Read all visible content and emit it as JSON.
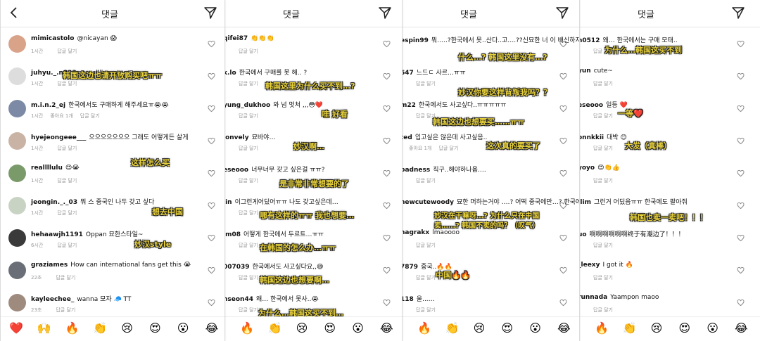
{
  "header_title": "댓글",
  "panel1": {
    "comments": [
      {
        "user": "mimicastolo",
        "text": "@nicayan 😱",
        "time": "1시간",
        "likes": "",
        "reply": "답글 달기",
        "anno": ""
      },
      {
        "user": "juhyu._.n822",
        "text": "@reallll._water  ㅋ‑",
        "time": "1시간",
        "likes": "",
        "reply": "답글 달기",
        "anno": "韩国这边也请开放购买吧ㅠㅠ"
      },
      {
        "user": "m.i.n.2_ej",
        "text": "한국에서도 구매하게 해주세요ㅠ😭😭",
        "time": "1시간",
        "likes": "좋아요 1개",
        "reply": "답글 달기",
        "anno": ""
      },
      {
        "user": "hyejeongeee___",
        "text": "으으으으으으으 그래도 어떻게든 살게",
        "time": "1시간",
        "likes": "",
        "reply": "답글 달기",
        "anno": "这样怎么买"
      },
      {
        "user": "reallllulu",
        "text": "😍😭",
        "time": "1시간",
        "likes": "",
        "reply": "답글 달기",
        "anno": ""
      },
      {
        "user": "jeongin._._03",
        "text": "뭐 스 중국인 나두 갖고 싶다",
        "time": "1시간",
        "likes": "",
        "reply": "답글 달기",
        "anno": "想去中国"
      },
      {
        "user": "hehaawjh1191",
        "text": "Oppan 묘한스타일~",
        "time": "6시간",
        "likes": "",
        "reply": "답글 달기",
        "anno": "妙汉style"
      },
      {
        "user": "graziames",
        "text": "How can international fans get this 😭",
        "time": "22초",
        "likes": "",
        "reply": "답글 달기",
        "anno": ""
      },
      {
        "user": "kayleechee_",
        "text": "wanna 모자 🧢 TT",
        "time": "23초",
        "likes": "",
        "reply": "답글 달기",
        "anno": ""
      }
    ]
  },
  "panel2": {
    "comments": [
      {
        "user": "qifei87",
        "text": "👏👏👏",
        "time": "",
        "likes": "",
        "reply": "답글 달기",
        "anno": ""
      },
      {
        "user": "k.lo",
        "text": "한국에서 구매를 못 해.. ?",
        "time": "",
        "likes": "",
        "reply": "답글 달기",
        "anno": "韩国这里为什么买不到…?"
      },
      {
        "user": "yung_dukhoo",
        "text": "와 넘 멋쳐 ,,,😳❤️",
        "time": "",
        "likes": "",
        "reply": "답글 달기",
        "anno": "哇 好看"
      },
      {
        "user": "lonvely",
        "text": "묘바야…",
        "time": "",
        "likes": "",
        "reply": "답글 달기",
        "anno": "妙汉啊…"
      },
      {
        "user": "eseooo",
        "text": "너무너무 갖고 싶은걸 ㅠㅠ?",
        "time": "",
        "likes": "",
        "reply": "답글 달기",
        "anno": "是非常非常想要的了"
      },
      {
        "user": "jin",
        "text": "이그런게어딨어ㅠㅠ 나도 갖고싶은데…",
        "time": "",
        "likes": "",
        "reply": "답글 달기",
        "anno": "哪有这样的ㅠㅠ 我也想要…"
      },
      {
        "user": "im08",
        "text": "어떻게 한국에서 두르트…ㅠㅠ",
        "time": "",
        "likes": "",
        "reply": "답글 달기",
        "anno": "在韩国的怎么办…ㅠㅠ"
      },
      {
        "user": "007039",
        "text": "한국에서도 사고싶다요,,😅",
        "time": "",
        "likes": "",
        "reply": "답글 달기",
        "anno": "韩国这边也想要啊…"
      },
      {
        "user": "nseon44",
        "text": "왜… 한국에서 못사..😭",
        "time": "",
        "likes": "",
        "reply": "답글 달기",
        "anno": "为什么…韩国这买不到…"
      }
    ]
  },
  "panel3": {
    "comments": [
      {
        "user": "espin99",
        "text": "뭐..…?한국에서 못..산다..고….??신묘한 너 이 배신하지?????",
        "time": "",
        "likes": "",
        "reply": "",
        "anno": "什么…? 韩国这里没有…?"
      },
      {
        "user": "647",
        "text": "느드ㄷ 사르…ㅠㅠ",
        "time": "",
        "likes": "",
        "reply": "답글 달기",
        "anno": "妙汉你要这样背叛我吗？？"
      },
      {
        "user": "m22",
        "text": "한국에서도 사고싶다..ㅠㅠㅠㅠㅠ",
        "time": "",
        "likes": "",
        "reply": "답글 달기",
        "anno": "韩国这边也想要买……ㅠㅠ"
      },
      {
        "user": "ted",
        "text": "입고싶은 않은데 사고싶음..",
        "time": "",
        "likes": "좋아요 1개",
        "reply": "답글 달기",
        "anno": "这次真的要买了"
      },
      {
        "user": "badness",
        "text": "직구..해야하나욤….",
        "time": "",
        "likes": "",
        "reply": "답글 달기",
        "anno": ""
      },
      {
        "user": "newcutewoody",
        "text": "묘한 머하는거야 ….? 어떡 중국에만…? 한국에선 안파는거에요? (한탄)",
        "time": "",
        "likes": "",
        "reply": "",
        "anno": "妙汉在干嘛呀…? 为什么只在中国卖……? 韩国不卖的吗？（叹气）"
      },
      {
        "user": "nagrakx",
        "text": "lmaoooo",
        "time": "",
        "likes": "",
        "reply": "답글 달기",
        "anno": ""
      },
      {
        "user": "7879",
        "text": "중국..🔥🔥",
        "time": "",
        "likes": "",
        "reply": "답글 달기",
        "anno": "中国🔥🔥"
      },
      {
        "user": "118",
        "text": "울...…",
        "time": "",
        "likes": "",
        "reply": "답글 달기",
        "anno": ""
      }
    ]
  },
  "panel4": {
    "comments": [
      {
        "user": "n0512",
        "text": "왜… 한국에서는 구매 모태..",
        "time": "",
        "likes": "",
        "reply": "답글 달기",
        "anno": "为什么…韩国这买不到"
      },
      {
        "user": "yun",
        "text": "cute~",
        "time": "",
        "likes": "",
        "reply": "답글 달기",
        "anno": ""
      },
      {
        "user": "eseooo",
        "text": "일등 ❤️",
        "time": "",
        "likes": "",
        "reply": "답글 달기",
        "anno": "一等❤️"
      },
      {
        "user": "onnkkii",
        "text": "대박 😊",
        "time": "",
        "likes": "",
        "reply": "답글 달기",
        "anno": "大发（真棒）"
      },
      {
        "user": "yoyo",
        "text": "😍👏👍",
        "time": "",
        "likes": "",
        "reply": "답글 달기",
        "anno": ""
      },
      {
        "user": ".lim",
        "text": "그런거 어딨음ㅠㅠ 한국에도 팔아줘",
        "time": "",
        "likes": "",
        "reply": "",
        "anno": "韩国也卖一卖吧！！！"
      },
      {
        "user": "uo",
        "text": "啊啊啊啊啊啊终于有潮边了！！！",
        "time": "",
        "likes": "",
        "reply": "답글 달기",
        "anno": ""
      },
      {
        "user": "_leexy",
        "text": "I got it 🔥",
        "time": "",
        "likes": "",
        "reply": "답글 달기",
        "anno": ""
      },
      {
        "user": "runnada",
        "text": "Yaampon maoo",
        "time": "",
        "likes": "",
        "reply": "답글 달기",
        "anno": ""
      }
    ]
  },
  "footer_emojis_p1": [
    "❤️",
    "🙌",
    "🔥",
    "👏",
    "😢",
    "😍",
    "😮",
    "😂"
  ],
  "footer_emojis_p2": [
    "🔥",
    "👏",
    "😢",
    "😍",
    "😮",
    "😂"
  ],
  "footer_emojis_p3": [
    "🔥",
    "👏",
    "😢",
    "😍",
    "😮",
    "😂"
  ],
  "footer_emojis_p4": [
    "🔥",
    "👏",
    "😢",
    "😍",
    "😮",
    "😂"
  ],
  "avatar_colors": [
    "#d9a38a",
    "#dddddd",
    "#7c8aa6",
    "#c9b3a5",
    "#7a9a6a",
    "#c8d3c4",
    "#3a3a3a",
    "#6a6f77",
    "#9f8a7e"
  ]
}
